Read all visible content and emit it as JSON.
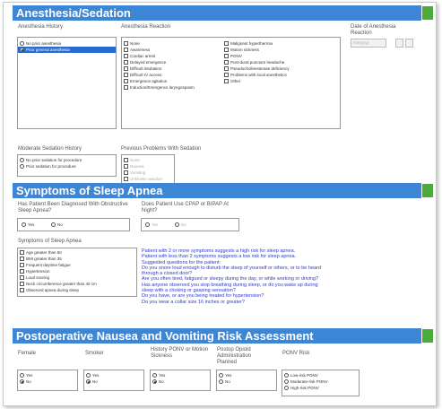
{
  "sections": {
    "anesthesia": "Anesthesia/Sedation",
    "sleep": "Symptoms of Sleep Apnea",
    "ponv": "Postoperative Nausea and Vomiting Risk Assessment"
  },
  "anesthesia": {
    "history_label": "Anesthesia History",
    "history_options": [
      "No prior anesthesia",
      "Prior general anesthesia"
    ],
    "reaction_label": "Anesthesia Reaction",
    "reaction_col1": [
      "None",
      "Awareness",
      "Cardiac arrest",
      "Delayed emergence",
      "Difficult intubation",
      "Difficult IV access",
      "Emergence agitation",
      "Induction/Emergence laryngospasm"
    ],
    "reaction_col2": [
      "Malignant hyperthermia",
      "Motion sickness",
      "PONV",
      "Post-dural puncture headache",
      "Pseudocholinesterase deficiency",
      "Problems with local anesthetics",
      "Other"
    ],
    "date_label": "Date of Anesthesia Reaction",
    "date_placeholder": "mm/yyyy",
    "moderate_label": "Moderate Sedation History",
    "moderate_options": [
      "No prior sedation for procedure",
      "Prior sedation for procedure"
    ],
    "previous_label": "Previous Problems With Sedation",
    "previous_options": [
      "None",
      "Nausea",
      "Vomiting",
      "Unknown reaction",
      "Other"
    ]
  },
  "sleep": {
    "diagnosed_label": "Has Patient Been Diagnosed With Obstructive Sleep Apnea?",
    "diagnosed_options": [
      "Yes",
      "No"
    ],
    "cpap_label": "Does Patient Use CPAP or BIPAP At Night?",
    "cpap_options": [
      "Yes",
      "No"
    ],
    "symptoms_label": "Symptoms of Sleep Apnea",
    "symptoms": [
      "Age greater than 50",
      "BMI greater than 35",
      "Frequent daytime fatigue",
      "Hypertension",
      "Loud snoring",
      "Neck circumference greater than 40 cm",
      "Observed apnea during sleep"
    ],
    "info": [
      "Patient with 2 or more symptoms suggests a high risk for sleep apnea.",
      "Patient with less than 2 symptoms suggests a low risk for sleep apnea.",
      "Suggested questions for the patient:",
      "Do you snore loud enough to disturb the sleep of yourself or others, or to be heard",
      "through a closed door?",
      "Are you often tired, fatigued or sleepy during the day, or while working or driving?",
      "Has anyone observed you stop breathing during sleep, or do you wake up during",
      "sleep with a choking or gasping sensation?",
      "Do you have, or are you being treated for hypertension?",
      "Do you wear a collar size 16 inches or greater?"
    ]
  },
  "ponv": {
    "female_label": "Female",
    "smoker_label": "Smoker",
    "history_label": "History PONV or Motion Sickness",
    "opioid_label": "Postop Opioid Administration Planned",
    "risk_label": "PONV Risk",
    "yes": "Yes",
    "no": "No",
    "risk_options": [
      "Low-risk PONV",
      "Moderate-risk PONV",
      "High-risk PONV"
    ]
  },
  "colors": {
    "header": "#3d86d6",
    "tab": "#4aaa3a",
    "info": "#2c3cc6",
    "selected": "#2a6bd1"
  }
}
